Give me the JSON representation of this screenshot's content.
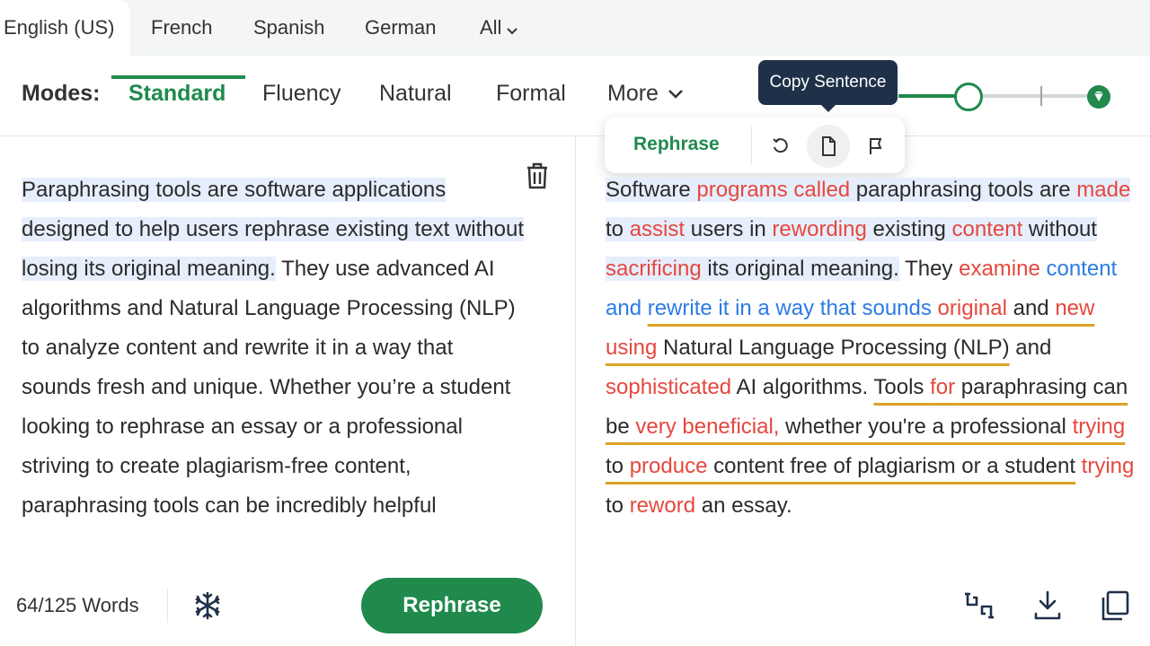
{
  "languages": {
    "tabs": [
      {
        "label": "English (US)",
        "active": true
      },
      {
        "label": "French",
        "active": false
      },
      {
        "label": "Spanish",
        "active": false
      },
      {
        "label": "German",
        "active": false
      }
    ],
    "all_label": "All"
  },
  "modes": {
    "label": "Modes:",
    "items": [
      {
        "label": "Standard",
        "active": true
      },
      {
        "label": "Fluency",
        "active": false
      },
      {
        "label": "Natural",
        "active": false
      },
      {
        "label": "Formal",
        "active": false
      }
    ],
    "more_label": "More"
  },
  "synonyms_slider": {
    "level": 0.35,
    "premium_icon": "gem-icon"
  },
  "tooltip": {
    "text": "Copy Sentence"
  },
  "sentence_popup": {
    "rephrase_label": "Rephrase",
    "icons": [
      "undo-icon",
      "copy-sentence-icon",
      "flag-icon"
    ]
  },
  "input": {
    "highlighted_sentence": "Paraphrasing tools are software applications designed to help users rephrase existing text without losing its original meaning.",
    "rest_text": " They use advanced AI algorithms and Natural Language Processing (NLP) to analyze content and rewrite it in a way that sounds fresh and unique. Whether you’re a student looking to rephrase an essay or a professional striving to create plagiarism-free content, paraphrasing tools can be incredibly helpful"
  },
  "output": {
    "segments": [
      {
        "t": "Software ",
        "c": "n",
        "h": true
      },
      {
        "t": "programs called",
        "c": "r",
        "h": true
      },
      {
        "t": " paraphrasing tools are ",
        "c": "n",
        "h": true
      },
      {
        "t": "made",
        "c": "r",
        "h": true
      },
      {
        "t": " to ",
        "c": "n",
        "h": true
      },
      {
        "t": "assist",
        "c": "r",
        "h": true
      },
      {
        "t": " users in ",
        "c": "n",
        "h": true
      },
      {
        "t": "rewording",
        "c": "r",
        "h": true
      },
      {
        "t": " existing ",
        "c": "n",
        "h": true
      },
      {
        "t": "content",
        "c": "r",
        "h": true
      },
      {
        "t": " without ",
        "c": "n",
        "h": true
      },
      {
        "t": "sacrificing",
        "c": "r",
        "h": true
      },
      {
        "t": " its original meaning.",
        "c": "n",
        "h": true
      },
      {
        "t": " They ",
        "c": "n",
        "h": false
      },
      {
        "t": "examine",
        "c": "r",
        "h": false
      },
      {
        "t": " ",
        "c": "n",
        "h": false
      },
      {
        "t": "content and",
        "c": "b",
        "h": false
      },
      {
        "t": " ",
        "c": "n",
        "h": false
      },
      {
        "t": "rewrite it in a way that sounds",
        "c": "b",
        "h": false,
        "u": true
      },
      {
        "t": " ",
        "c": "n",
        "h": false,
        "u": true
      },
      {
        "t": "original",
        "c": "r",
        "h": false,
        "u": true
      },
      {
        "t": " and ",
        "c": "n",
        "h": false,
        "u": true
      },
      {
        "t": "new using",
        "c": "r",
        "h": false,
        "u": true
      },
      {
        "t": " Natural Language Processing (NLP)",
        "c": "n",
        "h": false,
        "u": true
      },
      {
        "t": " and ",
        "c": "n",
        "h": false
      },
      {
        "t": "sophisticated",
        "c": "r",
        "h": false
      },
      {
        "t": " AI algorithms. ",
        "c": "n",
        "h": false
      },
      {
        "t": "Tools ",
        "c": "n",
        "h": false,
        "u": true
      },
      {
        "t": "for",
        "c": "r",
        "h": false,
        "u": true
      },
      {
        "t": " paraphrasing can be ",
        "c": "n",
        "h": false,
        "u": true
      },
      {
        "t": "very beneficial,",
        "c": "r",
        "h": false,
        "u": true
      },
      {
        "t": " whether you're a professional ",
        "c": "n",
        "h": false,
        "u": true
      },
      {
        "t": "trying",
        "c": "r",
        "h": false,
        "u": true
      },
      {
        "t": " to ",
        "c": "n",
        "h": false,
        "u": true
      },
      {
        "t": "produce",
        "c": "r",
        "h": false,
        "u": true
      },
      {
        "t": " content free of plagiarism or a student",
        "c": "n",
        "h": false,
        "u": true
      },
      {
        "t": " ",
        "c": "n",
        "h": false
      },
      {
        "t": "trying",
        "c": "r",
        "h": false
      },
      {
        "t": " to ",
        "c": "n",
        "h": false
      },
      {
        "t": "reword",
        "c": "r",
        "h": false
      },
      {
        "t": " an essay.",
        "c": "n",
        "h": false
      }
    ]
  },
  "footer": {
    "word_count": "64/125 Words",
    "rephrase_label": "Rephrase",
    "left_icons": [
      "freeze-words-icon"
    ],
    "right_icons": [
      "compare-icon",
      "download-icon",
      "copy-all-icon"
    ]
  },
  "colors": {
    "accent": "#1f8a4c",
    "changed_word": "#e5483e",
    "structural_change": "#2d7be5",
    "longest_unchanged": "#dca227",
    "highlight": "#e6eefc",
    "tooltip_bg": "#1e3148"
  }
}
